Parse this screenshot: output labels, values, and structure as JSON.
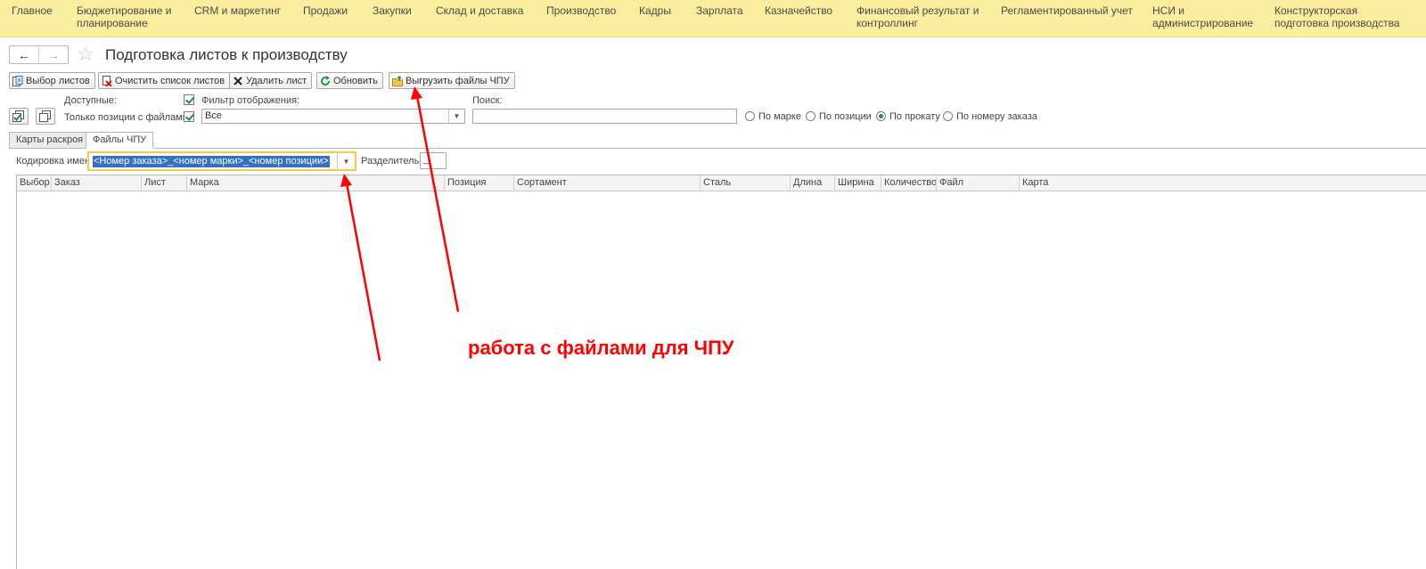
{
  "menu": [
    {
      "line1": "Главное",
      "line2": ""
    },
    {
      "line1": "Бюджетирование и",
      "line2": "планирование"
    },
    {
      "line1": "CRM и маркетинг",
      "line2": ""
    },
    {
      "line1": "Продажи",
      "line2": ""
    },
    {
      "line1": "Закупки",
      "line2": ""
    },
    {
      "line1": "Склад и доставка",
      "line2": ""
    },
    {
      "line1": "Производство",
      "line2": ""
    },
    {
      "line1": "Кадры",
      "line2": ""
    },
    {
      "line1": "Зарплата",
      "line2": ""
    },
    {
      "line1": "Казначейство",
      "line2": ""
    },
    {
      "line1": "Финансовый результат и",
      "line2": "контроллинг"
    },
    {
      "line1": "Регламентированный учет",
      "line2": ""
    },
    {
      "line1": "НСИ и",
      "line2": "администрирование"
    },
    {
      "line1": "Конструкторская",
      "line2": "подготовка производства"
    }
  ],
  "nav": {
    "back": "←",
    "forward": "→",
    "star": "☆"
  },
  "page_title": "Подготовка листов к производству",
  "toolbar": {
    "select_sheets": "Выбор листов",
    "clear_list": "Очистить список листов",
    "delete_sheet": "Удалить лист",
    "refresh": "Обновить",
    "export_cnc": "Выгрузить файлы ЧПУ"
  },
  "filters": {
    "available_label": "Доступные:",
    "only_with_files_label": "Только позиции с файлами:",
    "display_filter_label": "Фильтр отображения:",
    "display_filter_value": "Все",
    "search_label": "Поиск:",
    "search_value": "",
    "radio_options": [
      "По марке",
      "По позиции",
      "По прокату",
      "По номеру заказа"
    ],
    "radio_selected": "По прокату"
  },
  "tabs": [
    {
      "label": "Карты раскроя",
      "active": false
    },
    {
      "label": "Файлы ЧПУ",
      "active": true
    }
  ],
  "encoding": {
    "label": "Кодировка имен:",
    "value": "<Номер заказа>_<номер марки>_<номер позиции>",
    "separator_label": "Разделитель:",
    "separator_value": "_"
  },
  "table": {
    "columns": [
      "Выбор",
      "Заказ",
      "Лист",
      "Марка",
      "Позиция",
      "Сортамент",
      "Сталь",
      "Длина",
      "Ширина",
      "Количество",
      "Файл",
      "Карта"
    ],
    "rows": []
  },
  "annotation": "работа с файлами для ЧПУ",
  "colors": {
    "menu_bg": "#fbed9e",
    "annotation": "#ff0000",
    "focus": "#f2c94c",
    "selection": "#3470c8"
  }
}
